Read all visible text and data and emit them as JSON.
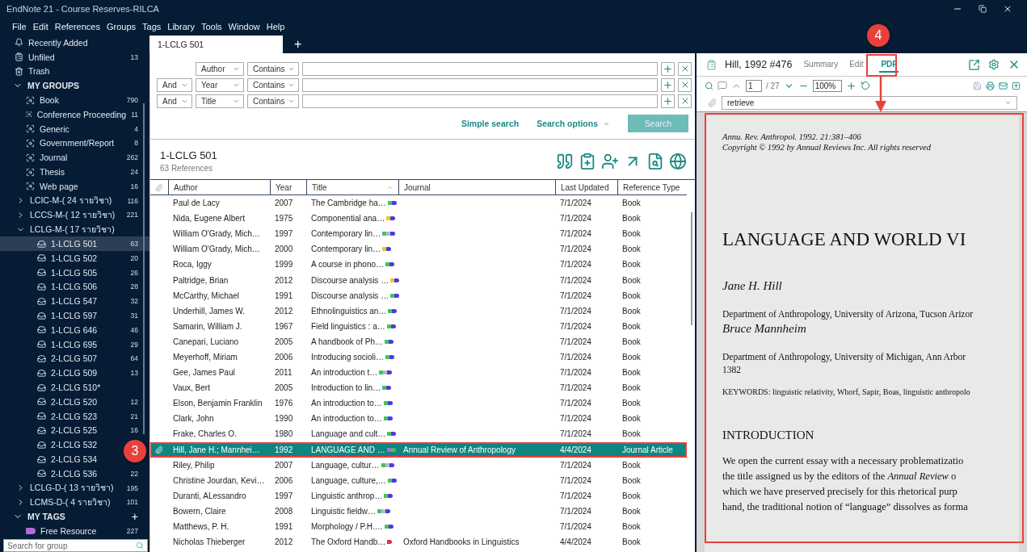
{
  "window": {
    "title": "EndNote 21 - Course Reserves-RILCA"
  },
  "menu": [
    "File",
    "Edit",
    "References",
    "Groups",
    "Tags",
    "Library",
    "Tools",
    "Window",
    "Help"
  ],
  "sidebar": {
    "library": [
      {
        "kind": "recent",
        "label": "Recently Added",
        "selected": false
      },
      {
        "kind": "unfiled",
        "label": "Unfiled",
        "count": "13",
        "selected": false
      },
      {
        "kind": "trash",
        "label": "Trash",
        "selected": false
      }
    ],
    "groups": {
      "title": "MY GROUPS",
      "expanded": true,
      "items": [
        {
          "kind": "smart",
          "label": "Book",
          "count": "790",
          "selected": false
        },
        {
          "kind": "smart",
          "label": "Conference Proceeding",
          "count": "11",
          "selected": false
        },
        {
          "kind": "smart",
          "label": "Generic",
          "count": "4",
          "selected": false
        },
        {
          "kind": "smart",
          "label": "Government/Report",
          "count": "8",
          "selected": false
        },
        {
          "kind": "smart",
          "label": "Journal",
          "count": "262",
          "selected": false
        },
        {
          "kind": "smart",
          "label": "Thesis",
          "count": "24",
          "selected": false
        },
        {
          "kind": "smart",
          "label": "Web page",
          "count": "16",
          "selected": false
        },
        {
          "kind": "set",
          "label": "LCIC-M-( 24 รายวิชา)",
          "count": "116",
          "expanded": false,
          "selected": false
        },
        {
          "kind": "set",
          "label": "LCCS-M-( 12 รายวิชา)",
          "count": "221",
          "expanded": false,
          "selected": false
        },
        {
          "kind": "set",
          "label": "LCLG-M-( 17 รายวิชา)",
          "expanded": true,
          "selected": false,
          "children": [
            {
              "kind": "group",
              "label": "1-LCLG 501",
              "count": "63",
              "selected": true
            },
            {
              "kind": "group",
              "label": "1-LCLG 502",
              "count": "20",
              "selected": false
            },
            {
              "kind": "group",
              "label": "1-LCLG 505",
              "count": "26",
              "selected": false
            },
            {
              "kind": "group",
              "label": "1-LCLG 506",
              "count": "28",
              "selected": false
            },
            {
              "kind": "group",
              "label": "1-LCLG 547",
              "count": "32",
              "selected": false
            },
            {
              "kind": "group",
              "label": "1-LCLG 597",
              "count": "31",
              "selected": false
            },
            {
              "kind": "group",
              "label": "1-LCLG 646",
              "count": "46",
              "selected": false
            },
            {
              "kind": "group",
              "label": "1-LCLG 695",
              "count": "29",
              "selected": false
            },
            {
              "kind": "group",
              "label": "2-LCLG 507",
              "count": "64",
              "selected": false
            },
            {
              "kind": "group",
              "label": "2-LCLG 509",
              "count": "13",
              "selected": false
            },
            {
              "kind": "group",
              "label": "2-LCLG 510*",
              "selected": false
            },
            {
              "kind": "group",
              "label": "2-LCLG 520",
              "count": "12",
              "selected": false
            },
            {
              "kind": "group",
              "label": "2-LCLG 523",
              "count": "21",
              "selected": false
            },
            {
              "kind": "group",
              "label": "2-LCLG 525",
              "count": "16",
              "selected": false
            },
            {
              "kind": "group",
              "label": "2-LCLG 532",
              "selected": false
            },
            {
              "kind": "group",
              "label": "2-LCLG 534",
              "selected": false
            },
            {
              "kind": "group",
              "label": "2-LCLG 536",
              "count": "22",
              "selected": false
            }
          ]
        },
        {
          "kind": "set",
          "label": "LCLG-D-( 13 รายวิชา)",
          "count": "195",
          "expanded": false,
          "selected": false
        },
        {
          "kind": "set",
          "label": "LCMS-D-( 4 รายวิชา)",
          "count": "101",
          "expanded": false,
          "selected": false
        }
      ]
    },
    "tags": {
      "title": "MY TAGS",
      "expanded": true,
      "add": "+",
      "items": [
        {
          "label": "Free Resource",
          "count": "227",
          "color": "#b36ad6",
          "selected": false
        }
      ]
    },
    "search": {
      "placeholder": "Search for group"
    }
  },
  "tabs": [
    {
      "label": "1-LCLG 501",
      "selected": true
    }
  ],
  "new_tab": "+",
  "search_rows": [
    {
      "field": "Author",
      "condition": "Contains"
    },
    {
      "op": "And",
      "field": "Year",
      "condition": "Contains"
    },
    {
      "op": "And",
      "field": "Title",
      "condition": "Contains"
    }
  ],
  "search_actions": {
    "simple": "Simple search",
    "options": "Search options",
    "search": "Search"
  },
  "library_header": {
    "title": "1-LCLG 501",
    "subtitle": "63 References"
  },
  "table": {
    "columns": [
      "Author",
      "Year",
      "Title",
      "Journal",
      "Last Updated",
      "Reference Type"
    ],
    "rows": [
      {
        "author": "Paul de Lacy",
        "year": "2007",
        "title": "The Cambridge ha…",
        "tags": [
          {
            "color": "#44c35a"
          },
          {
            "color": "#4b3be0"
          }
        ],
        "updated": "7/1/2024",
        "type": "Book",
        "selected": false
      },
      {
        "author": "Nida, Eugene Albert",
        "year": "1975",
        "title": "Componential ana…",
        "tags": [
          {
            "color": "#f2c230"
          },
          {
            "color": "#4b3be0"
          }
        ],
        "updated": "7/1/2024",
        "type": "Book",
        "selected": false
      },
      {
        "author": "William O'Grady, Mich…",
        "year": "1997",
        "title": "Contemporary lin…",
        "tags": [
          {
            "color": "#44c35a"
          },
          {
            "color": "#b8b8c8"
          },
          {
            "color": "#4b3be0"
          }
        ],
        "updated": "7/1/2024",
        "type": "Book",
        "selected": false
      },
      {
        "author": "William O'Grady, Mich…",
        "year": "2000",
        "title": "Contemporary lin…",
        "tags": [
          {
            "color": "#f2c230"
          },
          {
            "color": "#4b3be0"
          }
        ],
        "updated": "7/1/2024",
        "type": "Book",
        "selected": false
      },
      {
        "author": "Roca, Iggy",
        "year": "1999",
        "title": "A course in phono…",
        "tags": [
          {
            "color": "#44c35a"
          },
          {
            "color": "#4b3be0"
          }
        ],
        "updated": "7/1/2024",
        "type": "Book",
        "selected": false
      },
      {
        "author": "Paltridge, Brian",
        "year": "2012",
        "title": "Discourse analysis …",
        "tags": [
          {
            "color": "#f2c230"
          },
          {
            "color": "#4b3be0"
          }
        ],
        "updated": "7/1/2024",
        "type": "Book",
        "selected": false
      },
      {
        "author": "McCarthy, Michael",
        "year": "1991",
        "title": "Discourse analysis …",
        "tags": [
          {
            "color": "#44c35a"
          },
          {
            "color": "#4b3be0"
          }
        ],
        "updated": "7/1/2024",
        "type": "Book",
        "selected": false
      },
      {
        "author": "Underhill, James W.",
        "year": "2012",
        "title": "Ethnolinguistics an…",
        "tags": [
          {
            "color": "#44c35a"
          },
          {
            "color": "#4b3be0"
          }
        ],
        "updated": "7/1/2024",
        "type": "Book",
        "selected": false
      },
      {
        "author": "Samarin, William J.",
        "year": "1967",
        "title": "Field linguistics : a…",
        "tags": [
          {
            "color": "#44c35a"
          },
          {
            "color": "#4b3be0"
          }
        ],
        "updated": "7/1/2024",
        "type": "Book",
        "selected": false
      },
      {
        "author": "Canepari, Luciano",
        "year": "2005",
        "title": "A handbook of Ph…",
        "tags": [
          {
            "color": "#44c35a"
          },
          {
            "color": "#4b3be0"
          }
        ],
        "updated": "7/1/2024",
        "type": "Book",
        "selected": false
      },
      {
        "author": "Meyerhoff, Miriam",
        "year": "2006",
        "title": "Introducing socioli…",
        "tags": [
          {
            "color": "#44c35a"
          },
          {
            "color": "#4b3be0"
          }
        ],
        "updated": "7/1/2024",
        "type": "Book",
        "selected": false
      },
      {
        "author": "Gee, James Paul",
        "year": "2011",
        "title": "An introduction t…",
        "tags": [
          {
            "color": "#44c35a"
          },
          {
            "color": "#b8b8c8"
          },
          {
            "color": "#4b3be0"
          }
        ],
        "updated": "7/1/2024",
        "type": "Book",
        "selected": false
      },
      {
        "author": "Vaux, Bert",
        "year": "2005",
        "title": "Introduction to lin…",
        "tags": [
          {
            "color": "#44c35a"
          },
          {
            "color": "#4b3be0"
          }
        ],
        "updated": "7/1/2024",
        "type": "Book",
        "selected": false
      },
      {
        "author": "Elson, Benjamin Franklin",
        "year": "1976",
        "title": "An introduction to…",
        "tags": [
          {
            "color": "#44c35a"
          },
          {
            "color": "#4b3be0"
          }
        ],
        "updated": "7/1/2024",
        "type": "Book",
        "selected": false
      },
      {
        "author": "Clark, John",
        "year": "1990",
        "title": "An introduction to…",
        "tags": [
          {
            "color": "#44c35a"
          },
          {
            "color": "#4b3be0"
          }
        ],
        "updated": "7/1/2024",
        "type": "Book",
        "selected": false
      },
      {
        "author": "Frake, Charles O.",
        "year": "1980",
        "title": "Language and cult…",
        "tags": [
          {
            "color": "#44c35a"
          },
          {
            "color": "#4b3be0"
          }
        ],
        "updated": "7/1/2024",
        "type": "Book",
        "selected": false
      },
      {
        "attachment": true,
        "author": "Hill, Jane H.; Mannhei…",
        "year": "1992",
        "title": "LANGUAGE AND …",
        "tags": [
          {
            "color": "#b36ad6"
          },
          {
            "color": "#44c35a"
          }
        ],
        "journal": "Annual Review of Anthropology",
        "updated": "4/4/2024",
        "type": "Journal Article",
        "selected": true
      },
      {
        "author": "Riley, Philip",
        "year": "2007",
        "title": "Language, cultur…",
        "tags": [
          {
            "color": "#44c35a"
          },
          {
            "color": "#b8b8c8"
          },
          {
            "color": "#4b3be0"
          }
        ],
        "updated": "7/1/2024",
        "type": "Book",
        "selected": false
      },
      {
        "author": "Christine Jourdan, Kevi…",
        "year": "2006",
        "title": "Language, culture,…",
        "tags": [
          {
            "color": "#44c35a"
          },
          {
            "color": "#4b3be0"
          }
        ],
        "updated": "7/1/2024",
        "type": "Book",
        "selected": false
      },
      {
        "author": "Duranti, ALessandro",
        "year": "1997",
        "title": "Linguistic anthrop…",
        "tags": [
          {
            "color": "#44c35a"
          },
          {
            "color": "#4b3be0"
          }
        ],
        "updated": "7/1/2024",
        "type": "Book",
        "selected": false
      },
      {
        "author": "Bowern, Claire",
        "year": "2008",
        "title": "Linguistic fieldw…",
        "tags": [
          {
            "color": "#44c35a"
          },
          {
            "color": "#b8b8c8"
          },
          {
            "color": "#4b3be0"
          }
        ],
        "updated": "7/1/2024",
        "type": "Book",
        "selected": false
      },
      {
        "author": "Matthews, P. H.",
        "year": "1991",
        "title": "Morphology / P.H.…",
        "tags": [
          {
            "color": "#44c35a"
          },
          {
            "color": "#4b3be0"
          }
        ],
        "updated": "7/1/2024",
        "type": "Book",
        "selected": false
      },
      {
        "author": "Nicholas Thieberger",
        "year": "2012",
        "title": "The Oxford Handb…",
        "tags": [
          {
            "color": "#e0303a"
          }
        ],
        "journal": "Oxford Handbooks in Linguistics",
        "updated": "4/4/2024",
        "type": "Book",
        "selected": false
      }
    ]
  },
  "reference": {
    "title": "Hill, 1992 #476",
    "tabs": [
      {
        "label": "Summary",
        "selected": false
      },
      {
        "label": "Edit",
        "selected": false
      },
      {
        "label": "PDF",
        "selected": true
      }
    ],
    "page": "1",
    "page_count": "/ 27",
    "zoom": "100%",
    "attachment": "retrieve"
  },
  "pdf_page": {
    "lines": [
      {
        "kind": "citation",
        "text": "Annu. Rev. Anthropol. 1992. 21:381–406"
      },
      {
        "kind": "citation",
        "text": "Copyright © 1992 by Annual Reviews Inc. All rights reserved"
      },
      {
        "kind": "heading",
        "text": "LANGUAGE AND WORLD VI"
      },
      {
        "kind": "author",
        "text": "Jane H. Hill"
      },
      {
        "kind": "affiliation",
        "text": "Department of Anthropology, University of Arizona, Tucson Arizor"
      },
      {
        "kind": "author",
        "text": "Bruce Mannheim"
      },
      {
        "kind": "affiliation",
        "text": "Department of Anthropology, University of Michigan, Ann Arbor"
      },
      {
        "kind": "plain",
        "text": "1382"
      },
      {
        "kind": "keywords",
        "text": "KEYWORDS: linguistic relativity, Whorf, Sapir, Boas, linguistic anthropolo"
      },
      {
        "kind": "section",
        "text": "INTRODUCTION"
      },
      {
        "kind": "body",
        "text": "We open the current essay with a necessary problematizatio"
      },
      {
        "kind": "body",
        "text": "the title assigned us by the editors of the *Annual Review* o"
      },
      {
        "kind": "body",
        "text": "which we have preserved precisely for this rhetorical purp"
      },
      {
        "kind": "body",
        "text": "hand, the traditional notion of “language” dissolves as forma"
      }
    ]
  },
  "callouts": [
    {
      "kind": "row",
      "label": "3"
    },
    {
      "kind": "pdf",
      "label": "4"
    }
  ]
}
